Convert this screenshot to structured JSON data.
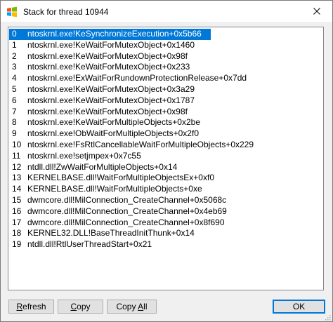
{
  "window": {
    "title": "Stack for thread 10944"
  },
  "stack": [
    {
      "index": "0",
      "frame": "ntoskrnl.exe!KeSynchronizeExecution+0x5b66",
      "selected": true
    },
    {
      "index": "1",
      "frame": "ntoskrnl.exe!KeWaitForMutexObject+0x1460"
    },
    {
      "index": "2",
      "frame": "ntoskrnl.exe!KeWaitForMutexObject+0x98f"
    },
    {
      "index": "3",
      "frame": "ntoskrnl.exe!KeWaitForMutexObject+0x233"
    },
    {
      "index": "4",
      "frame": "ntoskrnl.exe!ExWaitForRundownProtectionRelease+0x7dd"
    },
    {
      "index": "5",
      "frame": "ntoskrnl.exe!KeWaitForMutexObject+0x3a29"
    },
    {
      "index": "6",
      "frame": "ntoskrnl.exe!KeWaitForMutexObject+0x1787"
    },
    {
      "index": "7",
      "frame": "ntoskrnl.exe!KeWaitForMutexObject+0x98f"
    },
    {
      "index": "8",
      "frame": "ntoskrnl.exe!KeWaitForMultipleObjects+0x2be"
    },
    {
      "index": "9",
      "frame": "ntoskrnl.exe!ObWaitForMultipleObjects+0x2f0"
    },
    {
      "index": "10",
      "frame": "ntoskrnl.exe!FsRtlCancellableWaitForMultipleObjects+0x229"
    },
    {
      "index": "11",
      "frame": "ntoskrnl.exe!setjmpex+0x7c55"
    },
    {
      "index": "12",
      "frame": "ntdll.dll!ZwWaitForMultipleObjects+0x14"
    },
    {
      "index": "13",
      "frame": "KERNELBASE.dll!WaitForMultipleObjectsEx+0xf0"
    },
    {
      "index": "14",
      "frame": "KERNELBASE.dll!WaitForMultipleObjects+0xe"
    },
    {
      "index": "15",
      "frame": "dwmcore.dll!MilConnection_CreateChannel+0x5068c"
    },
    {
      "index": "16",
      "frame": "dwmcore.dll!MilConnection_CreateChannel+0x4eb69"
    },
    {
      "index": "17",
      "frame": "dwmcore.dll!MilConnection_CreateChannel+0x8f690"
    },
    {
      "index": "18",
      "frame": "KERNEL32.DLL!BaseThreadInitThunk+0x14"
    },
    {
      "index": "19",
      "frame": "ntdll.dll!RtlUserThreadStart+0x21"
    }
  ],
  "buttons": {
    "refresh_accel": "R",
    "refresh_rest": "efresh",
    "copy_accel": "C",
    "copy_rest": "opy",
    "copyall_pre": "Copy ",
    "copyall_accel": "A",
    "copyall_rest": "ll",
    "ok": "OK"
  },
  "icons": {
    "app": "windows-flag-icon",
    "close": "close-icon",
    "grip": "resize-grip-icon"
  },
  "colors": {
    "selection": "#0078d7",
    "window_bg": "#f0f0f0",
    "list_bg": "#ffffff"
  }
}
